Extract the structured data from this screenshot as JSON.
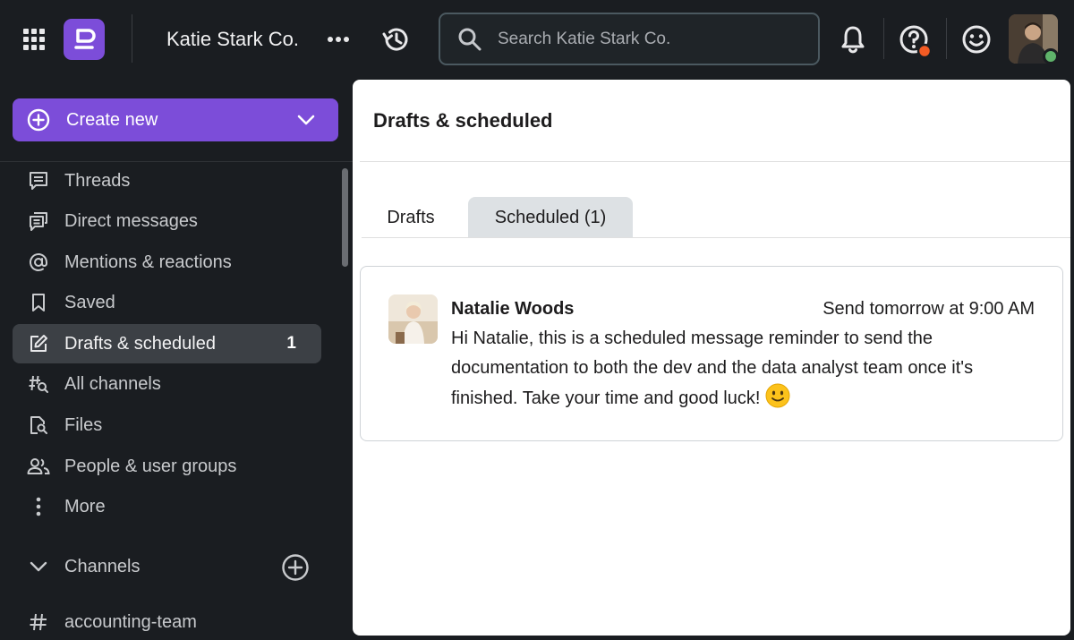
{
  "topbar": {
    "workspace_name": "Katie Stark Co.",
    "search_placeholder": "Search Katie Stark Co.",
    "help_badge_color": "#f35b24",
    "presence_color": "#5fb36a"
  },
  "sidebar": {
    "create_new_label": "Create new",
    "items": [
      {
        "label": "Threads",
        "icon": "threads-icon"
      },
      {
        "label": "Direct messages",
        "icon": "direct-messages-icon"
      },
      {
        "label": "Mentions & reactions",
        "icon": "at-sign-icon"
      },
      {
        "label": "Saved",
        "icon": "bookmark-icon"
      },
      {
        "label": "Drafts & scheduled",
        "icon": "pencil-icon",
        "badge": "1",
        "active": true
      },
      {
        "label": "All channels",
        "icon": "channel-search-icon"
      },
      {
        "label": "Files",
        "icon": "file-search-icon"
      },
      {
        "label": "People & user groups",
        "icon": "people-icon"
      },
      {
        "label": "More",
        "icon": "vertical-dots-icon"
      }
    ],
    "channels_header": "Channels",
    "channels": [
      {
        "name": "accounting-team"
      }
    ]
  },
  "main": {
    "title": "Drafts & scheduled",
    "tabs": [
      {
        "label": "Drafts",
        "active": false
      },
      {
        "label": "Scheduled (1)",
        "active": true
      }
    ],
    "message": {
      "sender": "Natalie Woods",
      "time": "Send tomorrow at 9:00 AM",
      "text": "Hi Natalie, this is a scheduled message reminder to send the documentation to both the dev and the data analyst team once it's finished. Take your time and good luck!",
      "emoji": "slightly-smiling-face"
    }
  },
  "colors": {
    "accent": "#7c4dd9",
    "sidebar_bg": "#1a1d21",
    "active_item_bg": "#3c4045",
    "tab_active_bg": "#dde1e4"
  }
}
